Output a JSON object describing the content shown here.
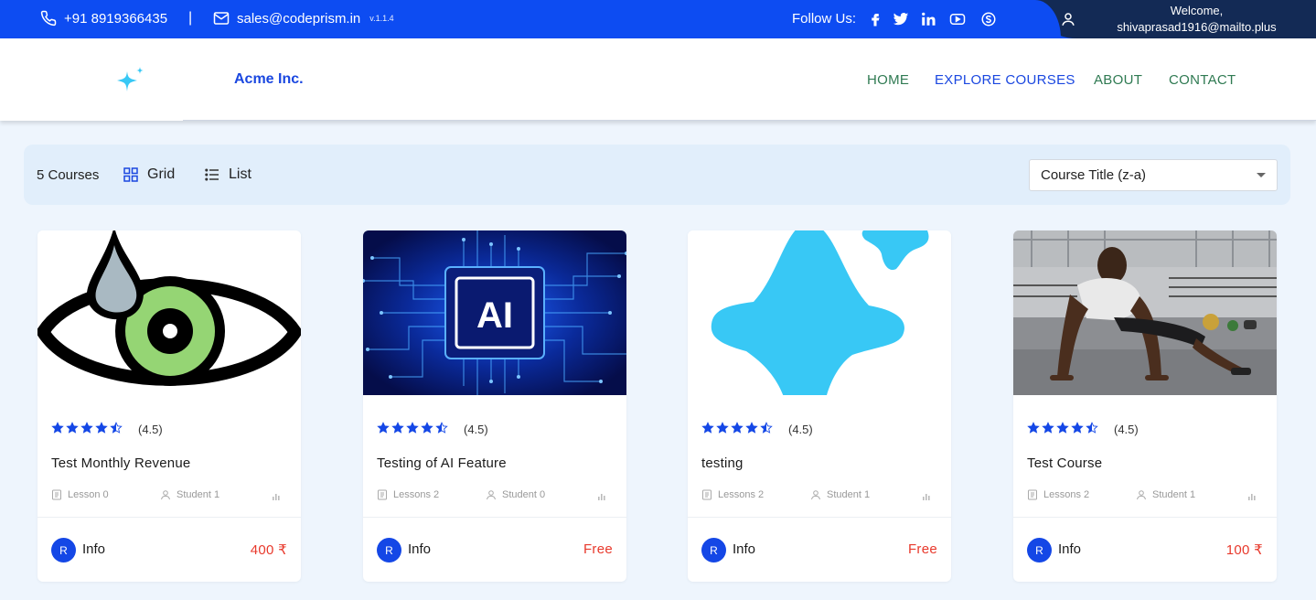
{
  "topbar": {
    "phone": "+91 8919366435",
    "separator": "|",
    "email": "sales@codeprism.in",
    "version": "v.1.1.4",
    "follow_label": "Follow Us:",
    "welcome_line1": "Welcome,",
    "welcome_line2": "shivaprasad1916@mailto.plus"
  },
  "header": {
    "brand": "Acme Inc.",
    "nav": [
      "HOME",
      "EXPLORE COURSES",
      "ABOUT",
      "CONTACT"
    ]
  },
  "toolbar": {
    "count": "5 Courses",
    "grid_label": "Grid",
    "list_label": "List",
    "sort_value": "Course Title (z-a)"
  },
  "courses": [
    {
      "rating": "(4.5)",
      "stars": 4.5,
      "title": "Test Monthly Revenue",
      "lessons": "Lesson 0",
      "students": "Student 1",
      "author_initial": "R",
      "author": "Info",
      "price": "400 ₹",
      "image": "eye-drop-illustration"
    },
    {
      "rating": "(4.5)",
      "stars": 4.5,
      "title": "Testing of AI Feature",
      "lessons": "Lessons 2",
      "students": "Student 0",
      "author_initial": "R",
      "author": "Info",
      "price": "Free",
      "image": "ai-chip-illustration"
    },
    {
      "rating": "(4.5)",
      "stars": 4.5,
      "title": "testing",
      "lessons": "Lessons 2",
      "students": "Student 1",
      "author_initial": "R",
      "author": "Info",
      "price": "Free",
      "image": "sparkle-logo"
    },
    {
      "rating": "(4.5)",
      "stars": 4.5,
      "title": "Test Course",
      "lessons": "Lessons 2",
      "students": "Student 1",
      "author_initial": "R",
      "author": "Info",
      "price": "100 ₹",
      "image": "gym-pushup-photo"
    }
  ],
  "colors": {
    "primary": "#0d4cf2",
    "navy": "#132a55",
    "nav_green": "#2f7a52",
    "price_red": "#e8392c",
    "sparkle": "#38c8f5"
  }
}
